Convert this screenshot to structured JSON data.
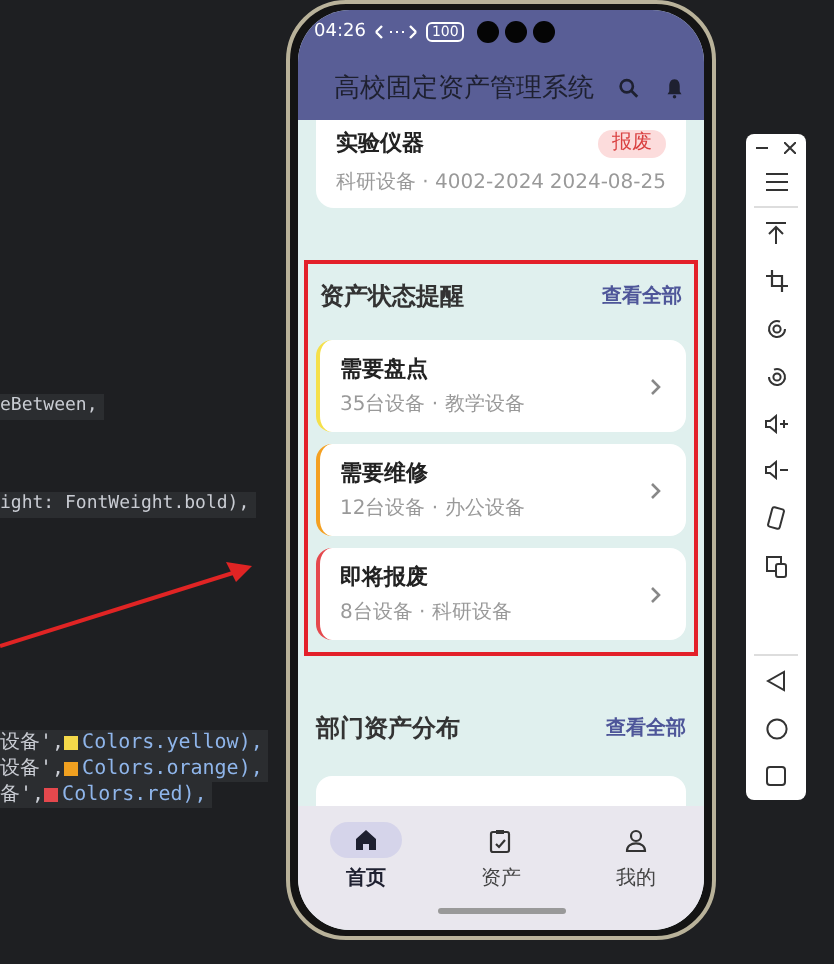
{
  "code_lines": [
    {
      "kind": "plain",
      "text": "eBetween,"
    },
    {
      "kind": "plain",
      "text": "ight: FontWeight.bold),"
    },
    {
      "kind": "swatch",
      "before": "设备', ",
      "color": "#f5d94a",
      "after": "Colors.yellow),"
    },
    {
      "kind": "swatch",
      "before": "设备', ",
      "color": "#f0a020",
      "after": "Colors.orange),"
    },
    {
      "kind": "swatch",
      "before": "备', ",
      "color": "#e5484d",
      "after": "Colors.red),"
    }
  ],
  "status_bar": {
    "time": "04:26",
    "battery": "100"
  },
  "app_bar": {
    "title": "高校固定资产管理系统"
  },
  "top_card": {
    "name": "实验仪器",
    "badge": "报废",
    "meta": "科研设备 · 4002-2024",
    "date": "2024-08-25"
  },
  "alerts": {
    "title": "资产状态提醒",
    "link": "查看全部",
    "items": [
      {
        "title": "需要盘点",
        "detail": "35台设备 · 教学设备",
        "color": "#f5e04a"
      },
      {
        "title": "需要维修",
        "detail": "12台设备 · 办公设备",
        "color": "#f4a021"
      },
      {
        "title": "即将报废",
        "detail": "8台设备 · 科研设备",
        "color": "#e5484d"
      }
    ]
  },
  "departments": {
    "title": "部门资产分布",
    "link": "查看全部"
  },
  "bottom_nav": [
    {
      "kind": "home",
      "label": "首页",
      "selected": true
    },
    {
      "kind": "assets",
      "label": "资产",
      "selected": false
    },
    {
      "kind": "profile",
      "label": "我的",
      "selected": false
    }
  ]
}
